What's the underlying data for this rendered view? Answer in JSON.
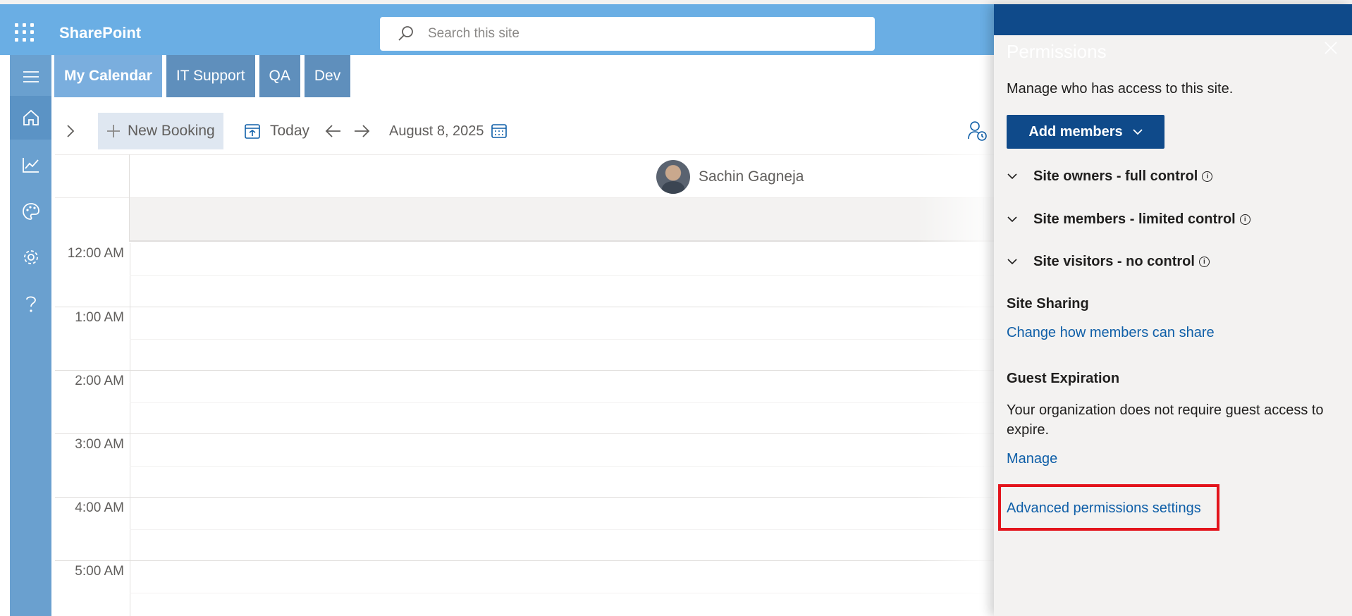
{
  "suite": {
    "app_name": "SharePoint",
    "search_placeholder": "Search this site"
  },
  "tabs": [
    {
      "label": "My Calendar",
      "active": true
    },
    {
      "label": "IT Support",
      "active": false
    },
    {
      "label": "QA",
      "active": false
    },
    {
      "label": "Dev",
      "active": false
    }
  ],
  "toolbar": {
    "new_booking": "New Booking",
    "today": "Today",
    "date": "August 8, 2025"
  },
  "calendar": {
    "person_name": "Sachin Gagneja",
    "hours": [
      "12:00 AM",
      "1:00 AM",
      "2:00 AM",
      "3:00 AM",
      "4:00 AM",
      "5:00 AM"
    ]
  },
  "permissions_panel": {
    "title": "Permissions",
    "description": "Manage who has access to this site.",
    "add_members": "Add members",
    "groups": [
      {
        "label": "Site owners - full control"
      },
      {
        "label": "Site members - limited control"
      },
      {
        "label": "Site visitors - no control"
      }
    ],
    "site_sharing_heading": "Site Sharing",
    "site_sharing_link": "Change how members can share",
    "guest_expiration_heading": "Guest Expiration",
    "guest_expiration_text": "Your organization does not require guest access to expire.",
    "manage_link": "Manage",
    "advanced_link": "Advanced permissions settings"
  },
  "colors": {
    "suite_bar": "#6aaee4",
    "panel_header": "#0f4a8a",
    "link": "#0f5fa8",
    "highlight_box": "#e3141c"
  }
}
